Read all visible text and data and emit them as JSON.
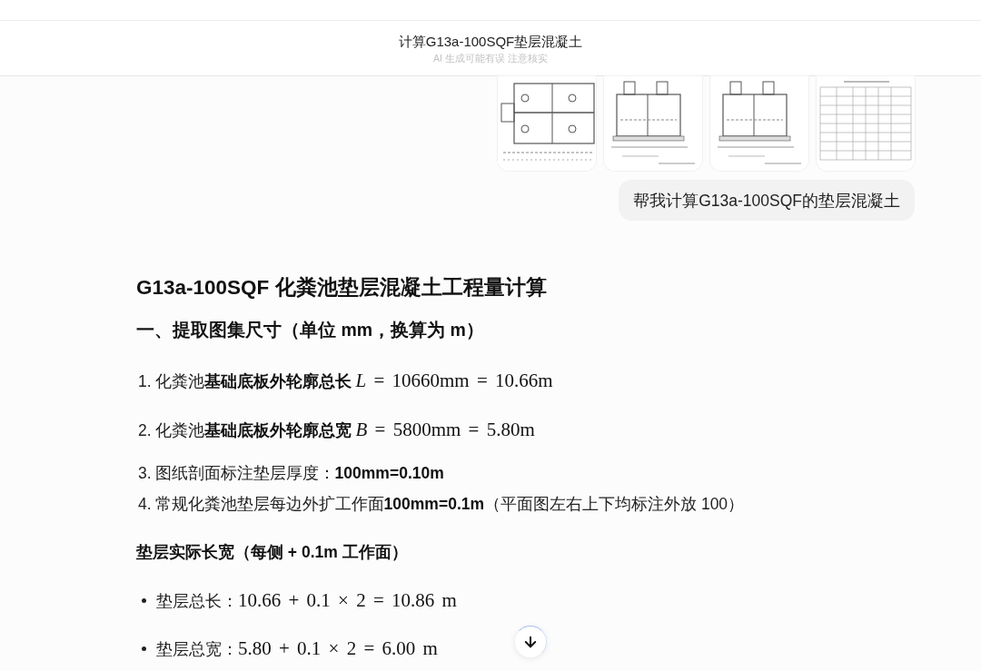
{
  "header": {
    "title": "计算G13a-100SQF垫层混凝土",
    "subtitle": "AI 生成可能有误 注意核实"
  },
  "attachments": [
    {
      "kind": "plan"
    },
    {
      "kind": "section"
    },
    {
      "kind": "section"
    },
    {
      "kind": "table"
    }
  ],
  "user_message": "帮我计算G13a-100SQF的垫层混凝土",
  "answer": {
    "title": "G13a-100SQF 化粪池垫层混凝土工程量计算",
    "section_heading": "一、提取图集尺寸（单位 mm，换算为 m）",
    "steps": [
      {
        "number": "1.",
        "text": "化粪池**基础底板外轮廓总长** ",
        "formula": "*L* = 10660mm = 10.66m"
      },
      {
        "number": "2.",
        "text": "化粪池**基础底板外轮廓总宽** ",
        "formula": "*B* = 5800mm = 5.80m"
      },
      {
        "number": "3.",
        "text": "图纸剖面标注垫层厚度：**100mm=0.10m**"
      },
      {
        "number": "4.",
        "text": "常规化粪池垫层每边外扩工作面**100mm=0.1m**（平面图左右上下均标注外放 100）"
      }
    ],
    "sub_heading": "垫层实际长宽（每侧 + 0.1m 工作面）",
    "bullets": [
      {
        "text": "垫层总长：",
        "formula": "10.66 + 0.1 × 2 = 10.86 m"
      },
      {
        "text": "垫层总宽：",
        "formula": "5.80 + 0.1 × 2 = 6.00 m"
      }
    ]
  }
}
